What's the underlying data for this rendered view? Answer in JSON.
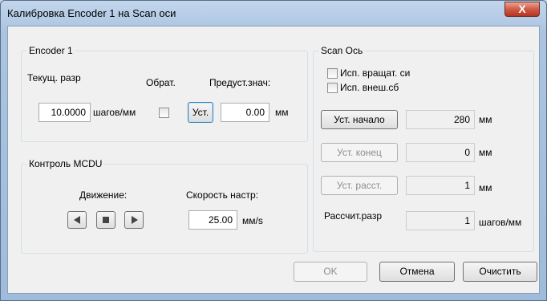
{
  "window": {
    "title": "Калибровка Encoder 1 на Scan оси",
    "close_glyph": "X"
  },
  "encoder": {
    "group_label": "Encoder 1",
    "current_label": "Текущ. разр",
    "invert_label": "Обрат.",
    "preset_label": "Предуст.знач:",
    "current_value": "10.0000",
    "current_unit": "шагов/мм",
    "set_button": "Уст.",
    "preset_value": "0.00",
    "preset_unit": "мм"
  },
  "mcdu": {
    "group_label": "Контроль MCDU",
    "motion_label": "Движение:",
    "speed_label": "Скорость настр:",
    "speed_value": "25.00",
    "speed_unit": "мм/s",
    "icons": [
      "play-left-icon",
      "stop-icon",
      "play-right-icon"
    ]
  },
  "scan": {
    "group_label": "Scan Ось",
    "rotary_label": "Исп. вращат. си",
    "external_label": "Исп. внеш.сб",
    "set_start_button": "Уст. начало",
    "start_value": "280",
    "start_unit": "мм",
    "set_end_button": "Уст. конец",
    "end_value": "0",
    "end_unit": "мм",
    "set_distance_button": "Уст. расст.",
    "distance_value": "1",
    "distance_unit": "мм",
    "calc_label": "Рассчит.разр",
    "calc_value": "1",
    "calc_unit": "шагов/мм"
  },
  "footer": {
    "ok": "OK",
    "cancel": "Отмена",
    "clear": "Очистить"
  },
  "colors": {
    "titlebar": "#aac4e0",
    "close_button": "#c8412c",
    "panel": "#f0f0f0"
  }
}
